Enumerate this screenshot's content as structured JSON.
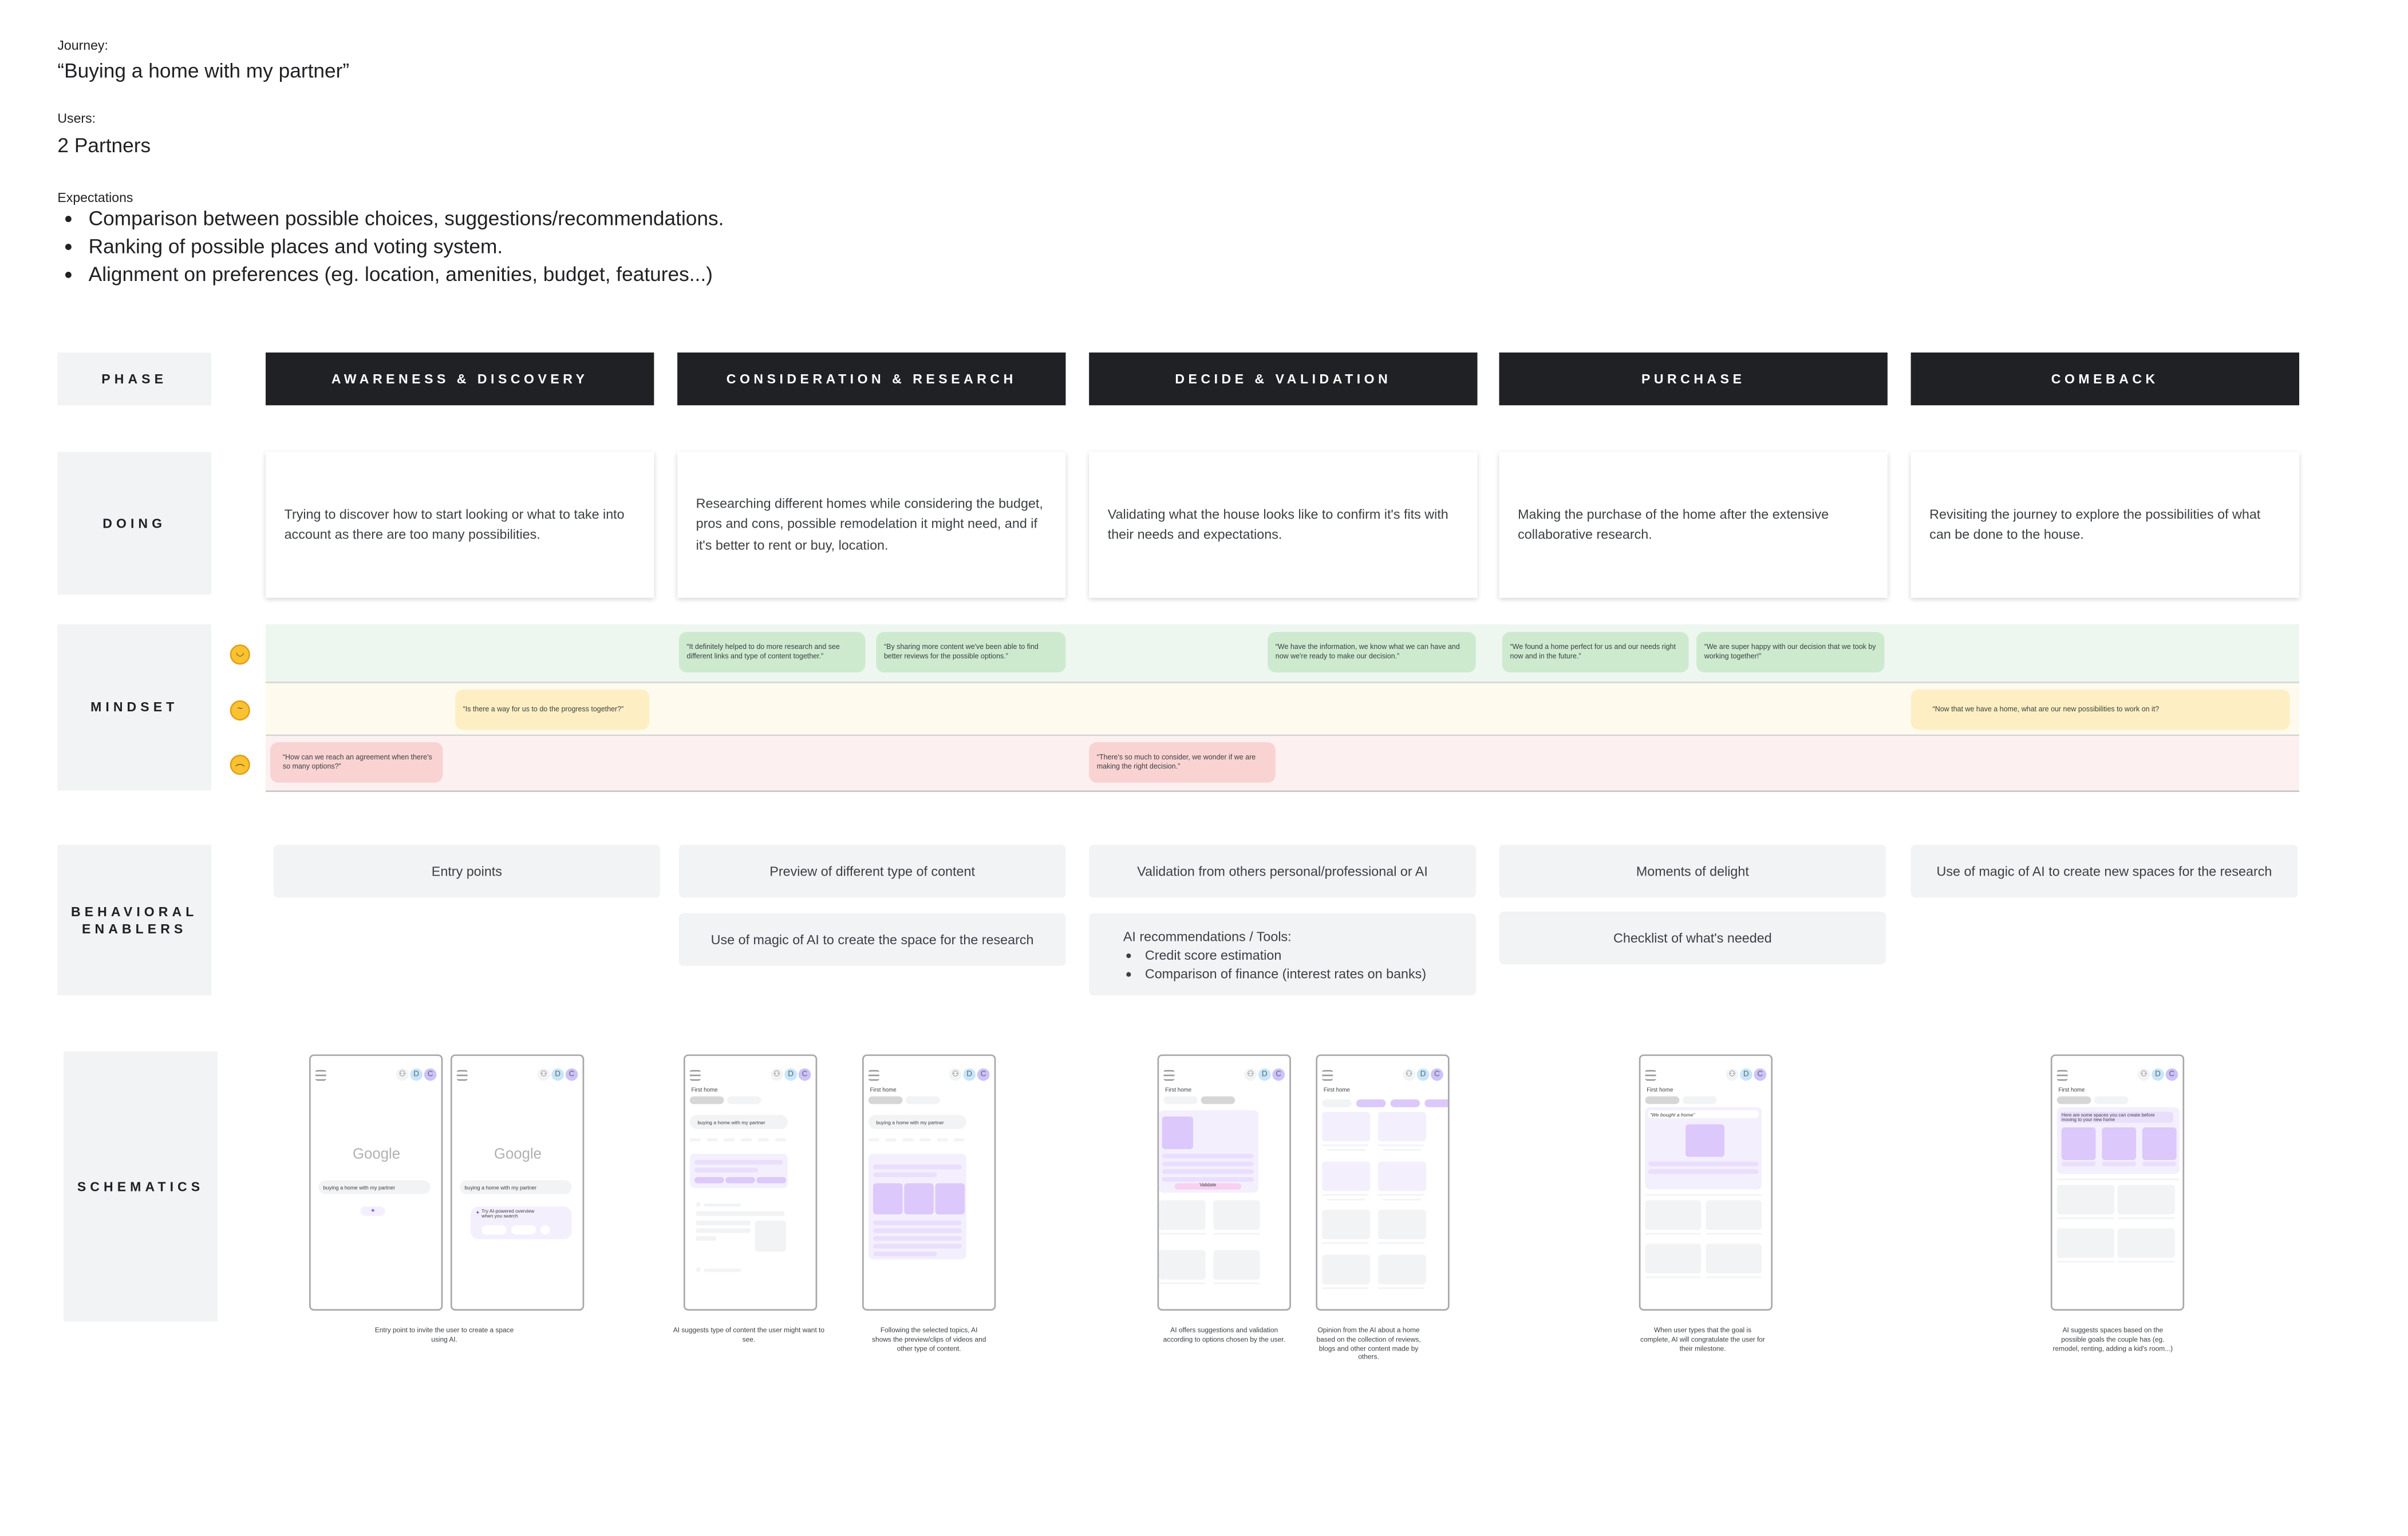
{
  "header": {
    "journey_label": "Journey:",
    "journey_value": "“Buying a home with my partner”",
    "users_label": "Users:",
    "users_value": "2 Partners",
    "expectations_label": "Expectations",
    "expectations": [
      "Comparison between possible choices, suggestions/recommendations.",
      "Ranking of possible places and voting system.",
      "Alignment on preferences (eg. location, amenities, budget, features...)"
    ]
  },
  "row_labels": {
    "phase": "PHASE",
    "doing": "DOING",
    "mindset": "MINDSET",
    "enablers": "BEHAVIORAL ENABLERS",
    "schematics": "SCHEMATICS"
  },
  "phases": [
    "AWARENESS & DISCOVERY",
    "CONSIDERATION & RESEARCH",
    "DECIDE & VALIDATION",
    "PURCHASE",
    "COMEBACK"
  ],
  "doing": [
    "Trying to discover how to start looking or what to take into account as there are too many possibilities.",
    "Researching different homes while considering the budget, pros and cons, possible remodelation it might need, and if it's better to rent or buy, location.",
    "Validating what the house looks like to confirm it's fits with their needs and expectations.",
    "Making the purchase of the home after the extensive collaborative research.",
    "Revisiting the journey to explore the possibilities of what can be done to the house."
  ],
  "mindset": {
    "colors": {
      "positive": "#cdeacf",
      "neutral": "#fdefc3",
      "negative": "#f9d2d2",
      "positive_band": "#eef6f0",
      "neutral_band": "#fefbee",
      "negative_band": "#fcf0f0"
    },
    "icons": [
      "slightly-smiling-face-icon",
      "thinking-face-icon",
      "slightly-frowning-face-icon"
    ],
    "positive": [
      "“It definitely helped to do more research and see different links and type of content together.”",
      "“By sharing more content we've been able to find better reviews for the possible options.”",
      "“We have the information, we know what we can have and now we're ready to make our decision.”",
      "“We found a home perfect for us and our needs right now and in the future.”",
      "“We are super happy with our decision that we took by working together!”"
    ],
    "neutral": [
      "“Is there a way for us to do the progress together?”",
      "“Now that we have a home, what are our new possibilities to work on it?"
    ],
    "negative": [
      "“How can we reach an agreement when there's so many options?”",
      "“There's so much to consider, we wonder if we are making the right decision.”"
    ]
  },
  "enablers": {
    "c1": "Entry points",
    "c2a": "Preview of different type of content",
    "c2b": "Use of magic of AI to create the space for the research",
    "c3a": "Validation from others personal/professional or AI",
    "c3b_title": "AI recommendations / Tools:",
    "c3b_items": [
      "Credit score estimation",
      "Comparison of finance (interest rates on banks)"
    ],
    "c4a": "Moments of delight",
    "c4b": "Checklist of what's needed",
    "c5": "Use of magic of AI to create new spaces for the research"
  },
  "schematics": {
    "accent": "#dcc8fb",
    "avatars": [
      "D",
      "C"
    ],
    "google": "Google",
    "query": "buying a home with my partner",
    "ai_overview": "Try AI-powered overview when you search",
    "space_title": "First home",
    "validate": "Validate",
    "bought": "“We bought a home”",
    "spaces_msg": "Here are some spaces you can create before moving to your new home",
    "captions": [
      "Entry point to invite the user to create a space using AI.",
      "AI suggests type of content the user might want to see.",
      "Following the selected topics, AI shows the preview/clips of videos and other type of content.",
      "AI offers suggestions and validation according to options chosen by the user.",
      "Opinion from the AI about a home based on the collection of reviews, blogs and other content made by others.",
      "When user types that the goal is complete, AI will congratulate the user for their milestone.",
      "AI suggests spaces based on the possible goals the couple has (eg. remodel, renting, adding a kid's room...)"
    ]
  }
}
